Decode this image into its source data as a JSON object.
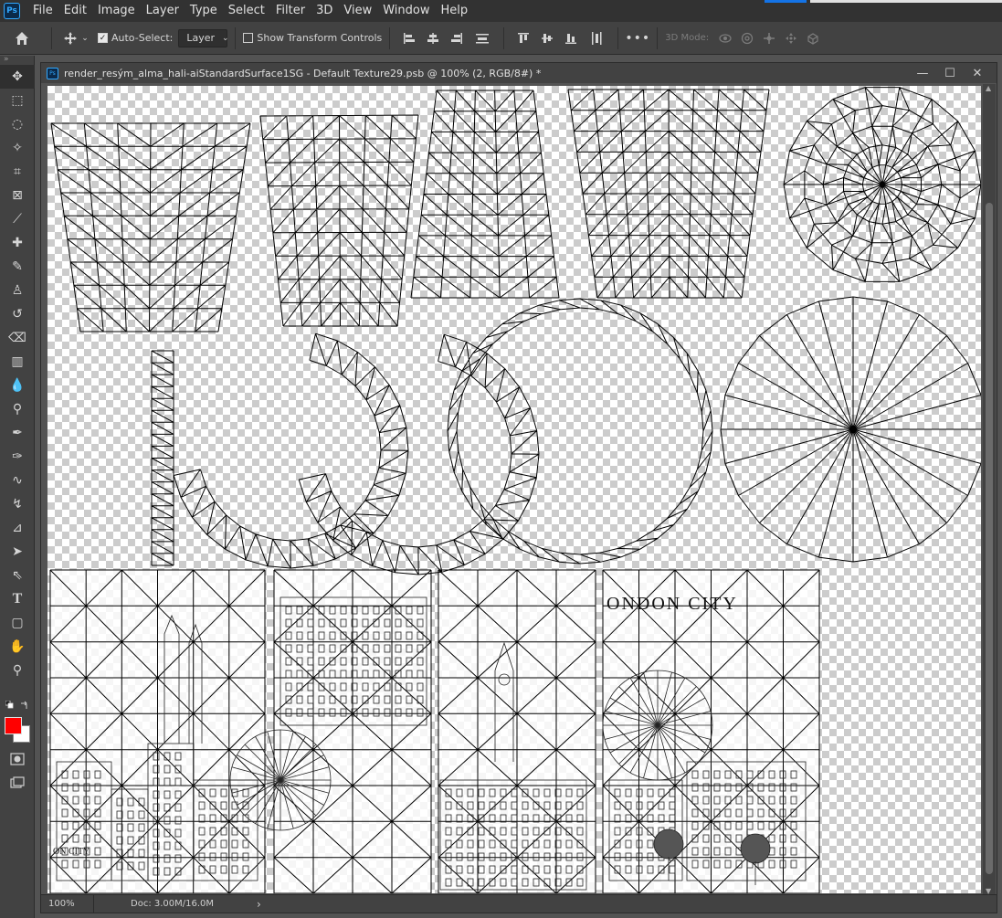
{
  "app": {
    "logo": "Ps",
    "menu": [
      "File",
      "Edit",
      "Image",
      "Layer",
      "Type",
      "Select",
      "Filter",
      "3D",
      "View",
      "Window",
      "Help"
    ]
  },
  "options_bar": {
    "auto_select_label": "Auto-Select:",
    "auto_select_checked": true,
    "layer_select_value": "Layer",
    "show_transform_label": "Show Transform Controls",
    "show_transform_checked": false,
    "mode_3d_label": "3D Mode:"
  },
  "document": {
    "title": "render_resým_alma_hali-aiStandardSurface1SG - Default Texture29.psb @ 100% (2, RGB/8#) *",
    "minimize_icon": "minimize-icon",
    "maximize_icon": "maximize-icon",
    "close_label": "✕",
    "texture_text": "ONDON CITY",
    "texture_text_small": "ON CITY"
  },
  "status_bar": {
    "zoom": "100%",
    "doc_size": "Doc: 3.00M/16.0M",
    "more_arrow": "›"
  },
  "colors": {
    "foreground": "#ff0000",
    "background": "#ffffff",
    "accent": "#31a8ff"
  },
  "tools": [
    "move-icon",
    "marquee-icon",
    "lasso-icon",
    "magic-wand-icon",
    "crop-icon",
    "frame-icon",
    "eyedropper-icon",
    "healing-icon",
    "brush-icon",
    "clone-stamp-icon",
    "history-brush-icon",
    "eraser-icon",
    "gradient-icon",
    "blur-icon",
    "dodge-icon",
    "pen-icon",
    "freeform-pen-icon",
    "curvature-pen-icon",
    "content-aware-icon",
    "anchor-icon",
    "path-select-icon",
    "direct-select-icon",
    "type-icon",
    "shape-icon",
    "hand-icon",
    "zoom-icon"
  ]
}
